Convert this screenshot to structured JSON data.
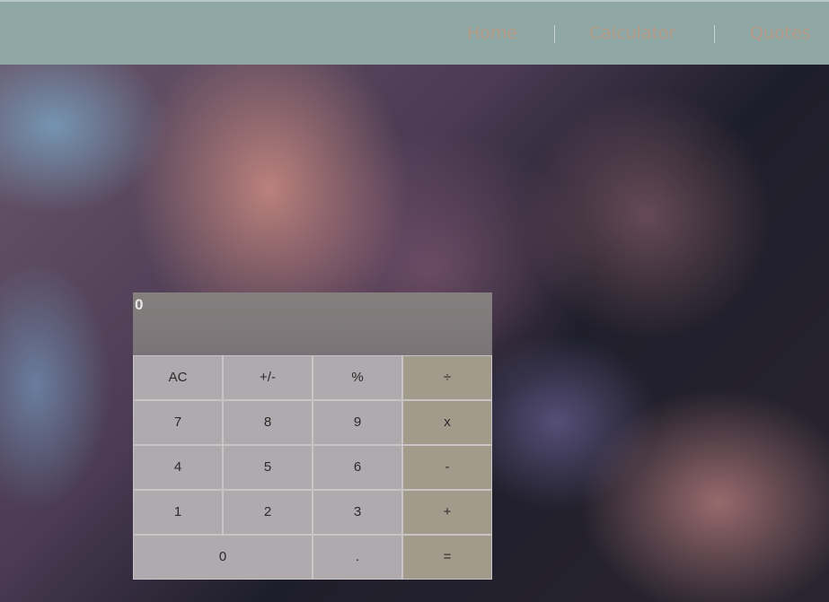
{
  "nav": {
    "links": [
      "Home",
      "Calculator",
      "Quotes"
    ],
    "separator": "|"
  },
  "calculator": {
    "display": "0",
    "rows": [
      [
        "AC",
        "+/-",
        "%",
        "÷"
      ],
      [
        "7",
        "8",
        "9",
        "x"
      ],
      [
        "4",
        "5",
        "6",
        "-"
      ],
      [
        "1",
        "2",
        "3",
        "+"
      ],
      [
        "0",
        ".",
        "="
      ]
    ]
  },
  "colors": {
    "navbar": "#8fa8a6",
    "nav_text": "#b79a86",
    "display_bg": "#7f797c",
    "key_bg": "#aeaaae",
    "operator_bg": "#a29a8a"
  }
}
